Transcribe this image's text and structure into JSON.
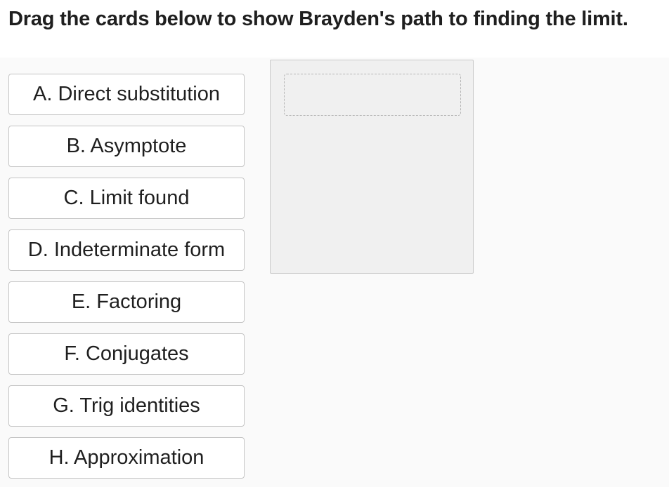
{
  "instruction": "Drag the cards below to show Brayden's path to finding the limit.",
  "cards": [
    {
      "label": "A. Direct substitution"
    },
    {
      "label": "B. Asymptote"
    },
    {
      "label": "C. Limit found"
    },
    {
      "label": "D. Indeterminate form"
    },
    {
      "label": "E. Factoring"
    },
    {
      "label": "F. Conjugates"
    },
    {
      "label": "G. Trig identities"
    },
    {
      "label": "H. Approximation"
    }
  ],
  "dropzone": {
    "slots_filled": 0,
    "slots": [
      {
        "label": ""
      }
    ]
  }
}
